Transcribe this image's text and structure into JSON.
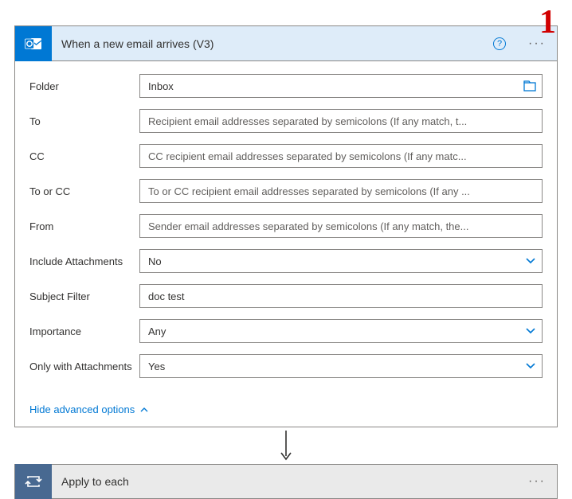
{
  "annotation": "1",
  "trigger": {
    "title": "When a new email arrives (V3)",
    "fields": {
      "folder": {
        "label": "Folder",
        "value": "Inbox"
      },
      "to": {
        "label": "To",
        "placeholder": "Recipient email addresses separated by semicolons (If any match, t..."
      },
      "cc": {
        "label": "CC",
        "placeholder": "CC recipient email addresses separated by semicolons (If any matc..."
      },
      "toOrCc": {
        "label": "To or CC",
        "placeholder": "To or CC recipient email addresses separated by semicolons (If any ..."
      },
      "from": {
        "label": "From",
        "placeholder": "Sender email addresses separated by semicolons (If any match, the..."
      },
      "includeAttachments": {
        "label": "Include Attachments",
        "value": "No"
      },
      "subjectFilter": {
        "label": "Subject Filter",
        "value": "doc test"
      },
      "importance": {
        "label": "Importance",
        "value": "Any"
      },
      "onlyWithAttachments": {
        "label": "Only with Attachments",
        "value": "Yes"
      }
    },
    "hideAdvanced": "Hide advanced options"
  },
  "apply": {
    "title": "Apply to each"
  }
}
